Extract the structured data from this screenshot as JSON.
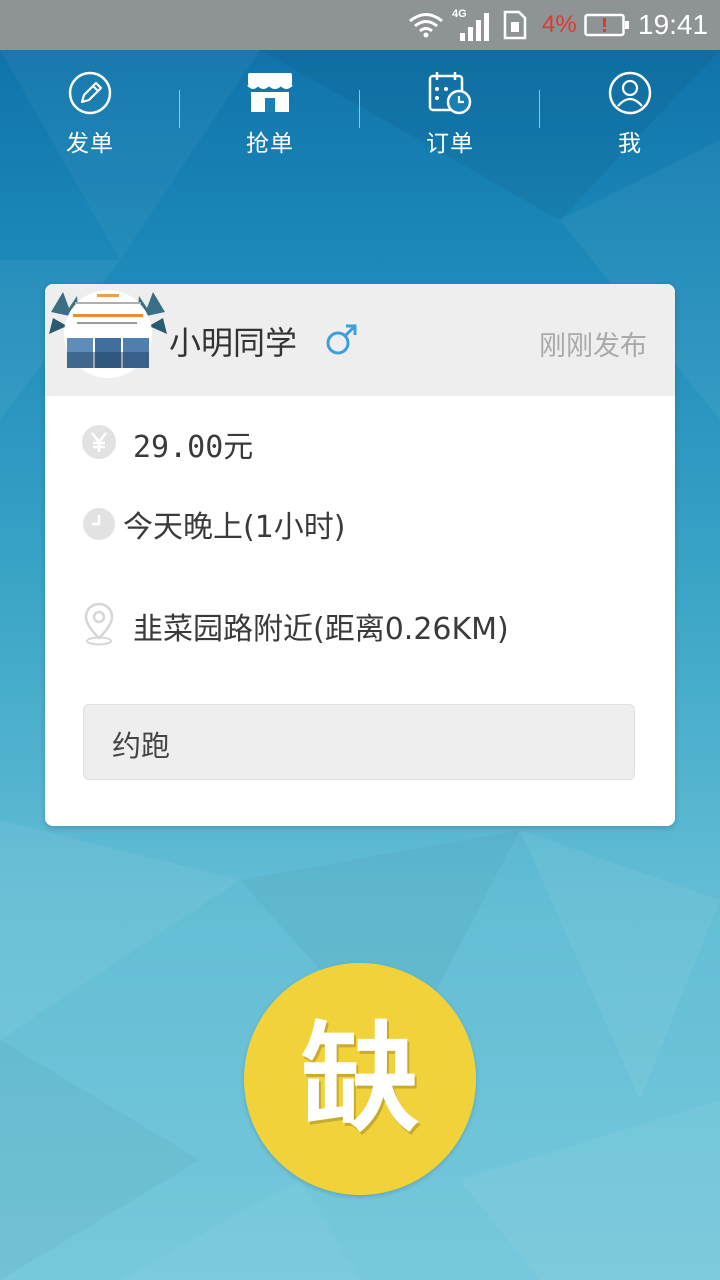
{
  "colors": {
    "background_top": "#0d6ea6",
    "background_bottom": "#77c8dc",
    "statusbar": "#8e9396",
    "battery_warning": "#e0392d",
    "card_header": "#eeeeee",
    "gender_male": "#3a9fdc",
    "button_yellow": "#f2d23b"
  },
  "statusbar": {
    "network_label": "4G",
    "battery_percent": "4%",
    "time": "19:41",
    "icons": [
      "wifi-icon",
      "signal-icon",
      "sim-alert-icon",
      "battery-low-icon"
    ]
  },
  "tabs": [
    {
      "label": "发单",
      "icon": "pencil-icon"
    },
    {
      "label": "抢单",
      "icon": "store-icon"
    },
    {
      "label": "订单",
      "icon": "calendar-clock-icon"
    },
    {
      "label": "我",
      "icon": "user-icon"
    }
  ],
  "order_card": {
    "user": {
      "name": "小明同学",
      "gender_icon": "male-icon"
    },
    "post_time": "刚刚发布",
    "price": "29.00元",
    "price_icon": "yen-icon",
    "time": "今天晚上(1小时)",
    "time_icon": "clock-icon",
    "location": "韭菜园路附近(距离0.26KM)",
    "location_icon": "location-pin-icon",
    "note": "约跑"
  },
  "action_button": {
    "label": "缺"
  }
}
